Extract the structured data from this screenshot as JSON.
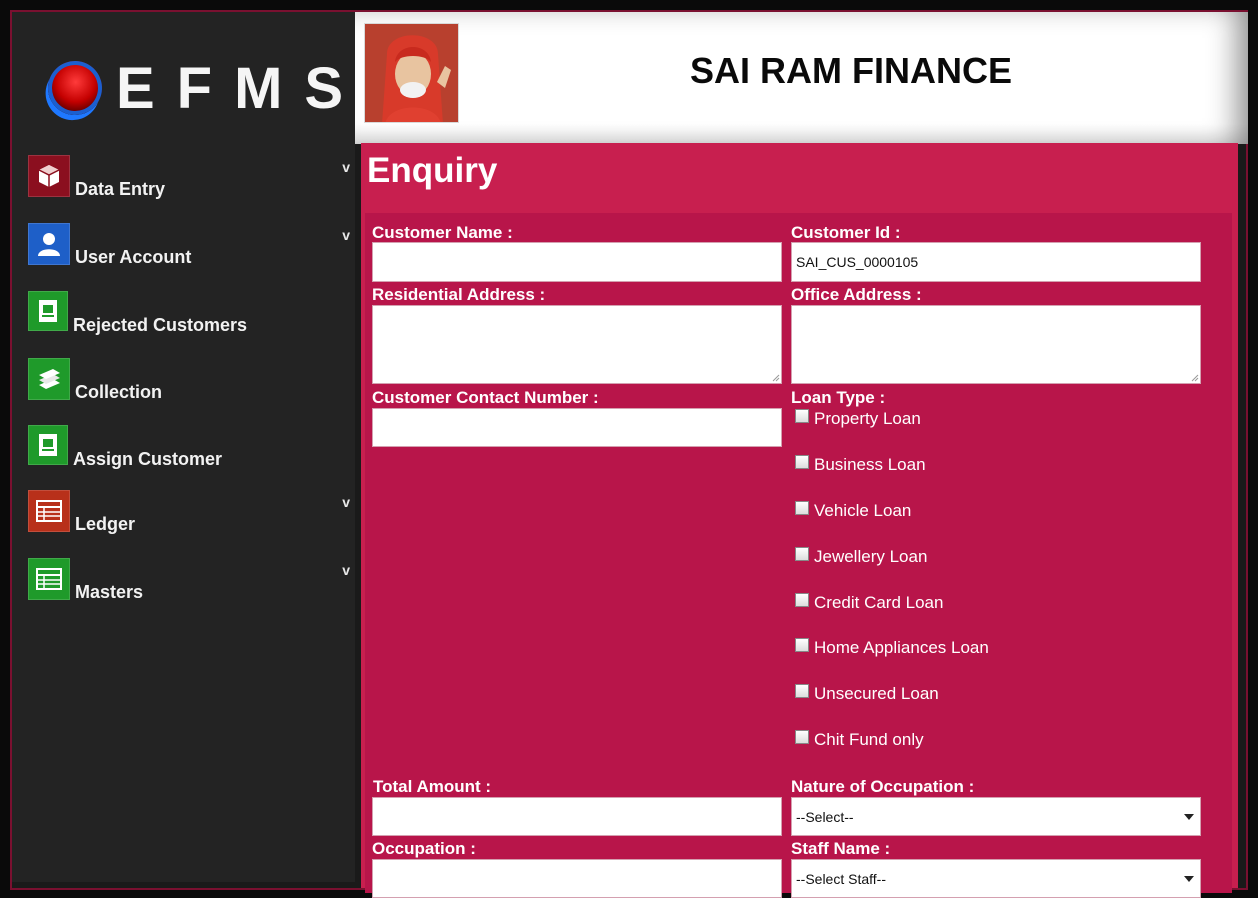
{
  "app": {
    "logo_text": "EFMS",
    "company_name": "SAI RAM FINANCE"
  },
  "sidebar": {
    "items": [
      {
        "label": "Data Entry",
        "icon": "cube-icon",
        "color": "#8b0f1f",
        "has_submenu": true
      },
      {
        "label": "User Account",
        "icon": "user-icon",
        "color": "#1e5fc8",
        "has_submenu": true
      },
      {
        "label": "Rejected Customers",
        "icon": "document-icon",
        "color": "#1f9a2a",
        "has_submenu": false
      },
      {
        "label": "Collection",
        "icon": "stack-icon",
        "color": "#1f9a2a",
        "has_submenu": false
      },
      {
        "label": "Assign Customer",
        "icon": "document-icon",
        "color": "#1f9a2a",
        "has_submenu": false
      },
      {
        "label": "Ledger",
        "icon": "ledger-icon",
        "color": "#b8301a",
        "has_submenu": true
      },
      {
        "label": "Masters",
        "icon": "grid-icon",
        "color": "#1f9a2a",
        "has_submenu": true
      }
    ],
    "chevron": "v"
  },
  "form": {
    "title": "Enquiry",
    "customer_name_label": "Customer Name :",
    "customer_name_value": "",
    "customer_id_label": "Customer Id :",
    "customer_id_value": "SAI_CUS_0000105",
    "residential_address_label": "Residential Address :",
    "office_address_label": "Office Address :",
    "contact_number_label": "Customer Contact Number :",
    "loan_type_label": "Loan Type :",
    "loan_types": [
      "Property Loan",
      "Business Loan",
      "Vehicle Loan",
      "Jewellery Loan",
      "Credit Card Loan",
      "Home Appliances Loan",
      "Unsecured Loan",
      "Chit Fund only"
    ],
    "total_amount_label": "Total Amount :",
    "nature_of_occupation_label": "Nature of Occupation :",
    "nature_of_occupation_value": "--Select--",
    "occupation_label": "Occupation :",
    "staff_name_label": "Staff Name :",
    "staff_name_value": "--Select Staff--"
  },
  "colors": {
    "panel": "#c81f4f",
    "form_area": "#b8154a",
    "sidebar": "#232323"
  }
}
